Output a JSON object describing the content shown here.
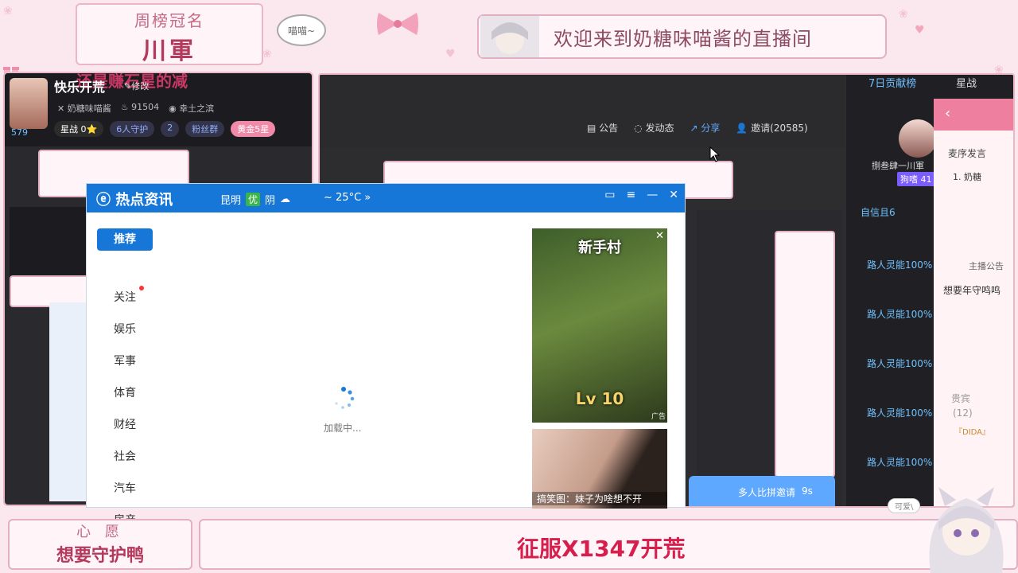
{
  "overlay": {
    "rank_title": "周榜冠名",
    "rank_name": "川軍",
    "bubble_text": "喵喵~",
    "welcome_text": "欢迎来到奶糖味喵酱的直播间",
    "wish_title": "心 愿",
    "wish_text": "想要守护鸭",
    "goal_text": "征服X1347开荒",
    "cute_tag": "可爱\\",
    "colors": {
      "pink_border": "#e2b0c0",
      "accent": "#d81e4c",
      "blue": "#1677d9"
    }
  },
  "stream_left": {
    "overlay_title": "还是赚石星的减",
    "streamer_name": "快乐开荒",
    "edit_label": "修改",
    "room_id_partial": "579",
    "channel": "奶糖味喵酱",
    "fans": "91504",
    "location": "幸土之滨",
    "star_label": "星战",
    "star_count": "0",
    "guardians": "6人守护",
    "fan_count": "2",
    "fan_group": "粉丝群",
    "level": "黄金5星"
  },
  "stream_right": {
    "tools": {
      "announce": "公告",
      "dynamic": "发动态",
      "share": "分享",
      "invite": "邀请(20585)"
    },
    "tabs": [
      "7日贡献榜",
      "星战"
    ],
    "top_user": "捌叁肆一川軍",
    "top_badge": "狗嗜 41",
    "announce_prefix": "自信且6",
    "list_items": [
      "路人灵能100%",
      "路人灵能100%",
      "路人灵能100%",
      "路人灵能100%",
      "路人灵能100%"
    ],
    "mic_order": "麦序发言",
    "rank1": "1. 奶糖",
    "host_pub": "主播公告",
    "wish": "想要年守鸣鸣",
    "guests_label": "贵宾",
    "guests_count": "(12)",
    "guest_first": "『DIDA』",
    "pk_invite": "多人比拼邀请",
    "pk_time": "9s"
  },
  "news_popup": {
    "brand": "热点资讯",
    "city": "昆明",
    "air": "优",
    "weather": "阴",
    "temp": "~ 25°C »",
    "categories": [
      "推荐",
      "关注",
      "娱乐",
      "军事",
      "体育",
      "财经",
      "社会",
      "汽车",
      "房产"
    ],
    "loading": "加载中...",
    "ad1_title": "新手村",
    "ad1_level": "Lv 10",
    "ad1_tag": "广告",
    "ad2_caption": "搞笑图：妹子为啥想不开"
  }
}
